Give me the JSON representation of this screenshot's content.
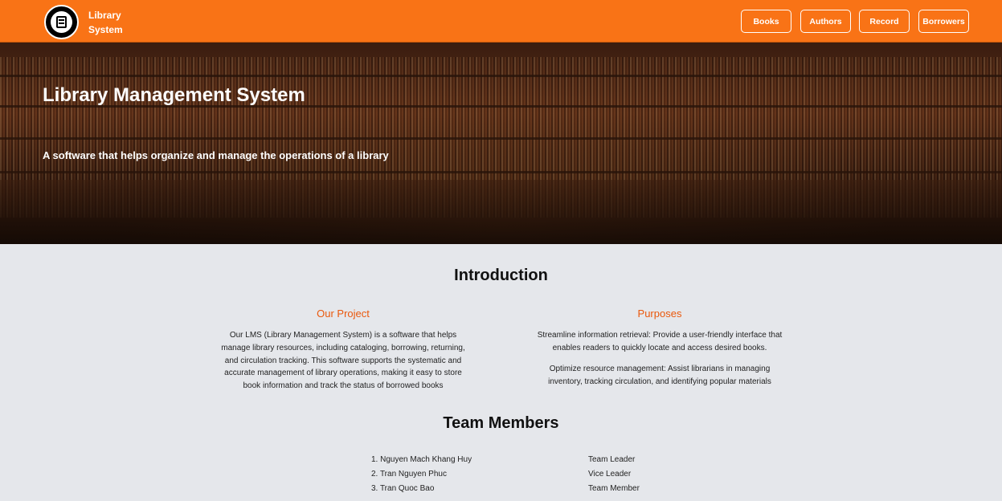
{
  "header": {
    "brand_line1": "Library",
    "brand_line2": "System",
    "nav": [
      "Books",
      "Authors",
      "Record",
      "Borrowers"
    ],
    "accent_color": "#f97316"
  },
  "hero": {
    "title": "Library Management System",
    "subtitle": "A software that helps organize and manage the operations of a library"
  },
  "introduction": {
    "title": "Introduction",
    "project": {
      "heading": "Our Project",
      "lines": [
        "Our LMS (Library Management System) is a software that helps",
        "manage library resources, including cataloging, borrowing, returning,",
        "and circulation tracking. This software supports the systematic and",
        "accurate management of library operations, making it easy to store",
        "book information and track the status of borrowed books"
      ]
    },
    "purposes": {
      "heading": "Purposes",
      "p1_lines": [
        "Streamline information retrieval: Provide a user-friendly interface that",
        "enables readers to quickly locate and access desired books."
      ],
      "p2_lines": [
        "Optimize resource management: Assist librarians in managing",
        "inventory, tracking circulation, and identifying popular materials"
      ]
    }
  },
  "team": {
    "title": "Team Members",
    "members": [
      {
        "name": "1. Nguyen Mach Khang Huy",
        "role": "Team Leader"
      },
      {
        "name": "2. Tran Nguyen Phuc",
        "role": "Vice Leader"
      },
      {
        "name": "3. Tran Quoc Bao",
        "role": "Team Member"
      }
    ]
  }
}
